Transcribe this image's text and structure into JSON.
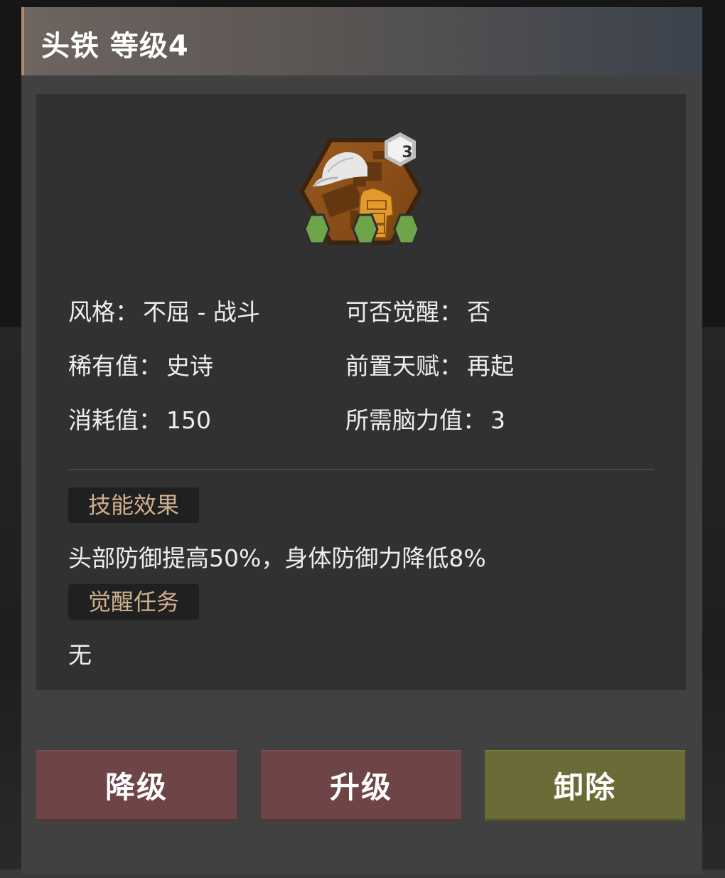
{
  "modal": {
    "title": "头铁 等级4"
  },
  "talent": {
    "icon": "helmet-cap-vest-talent-icon",
    "badge_level": "3",
    "slots_filled": 3,
    "stats": {
      "style_label": "风格：",
      "style_value": "不屈 - 战斗",
      "awaken_label": "可否觉醒：",
      "awaken_value": "否",
      "rarity_label": "稀有值：",
      "rarity_value": "史诗",
      "prereq_label": "前置天赋：",
      "prereq_value": "再起",
      "cost_label": "消耗值：",
      "cost_value": "150",
      "brain_label": "所需脑力值：",
      "brain_value": "3"
    },
    "effect_tag": "技能效果",
    "effect_text": "头部防御提高50%，身体防御力降低8%",
    "awaken_tag": "觉醒任务",
    "awaken_text": "无"
  },
  "buttons": {
    "downgrade": "降级",
    "upgrade": "升级",
    "remove": "卸除"
  },
  "colors": {
    "accent_tag_text": "#cdb08e",
    "button_red": "#6e4446",
    "button_olive": "#6a6b36",
    "slot_green": "#6ea54a"
  }
}
